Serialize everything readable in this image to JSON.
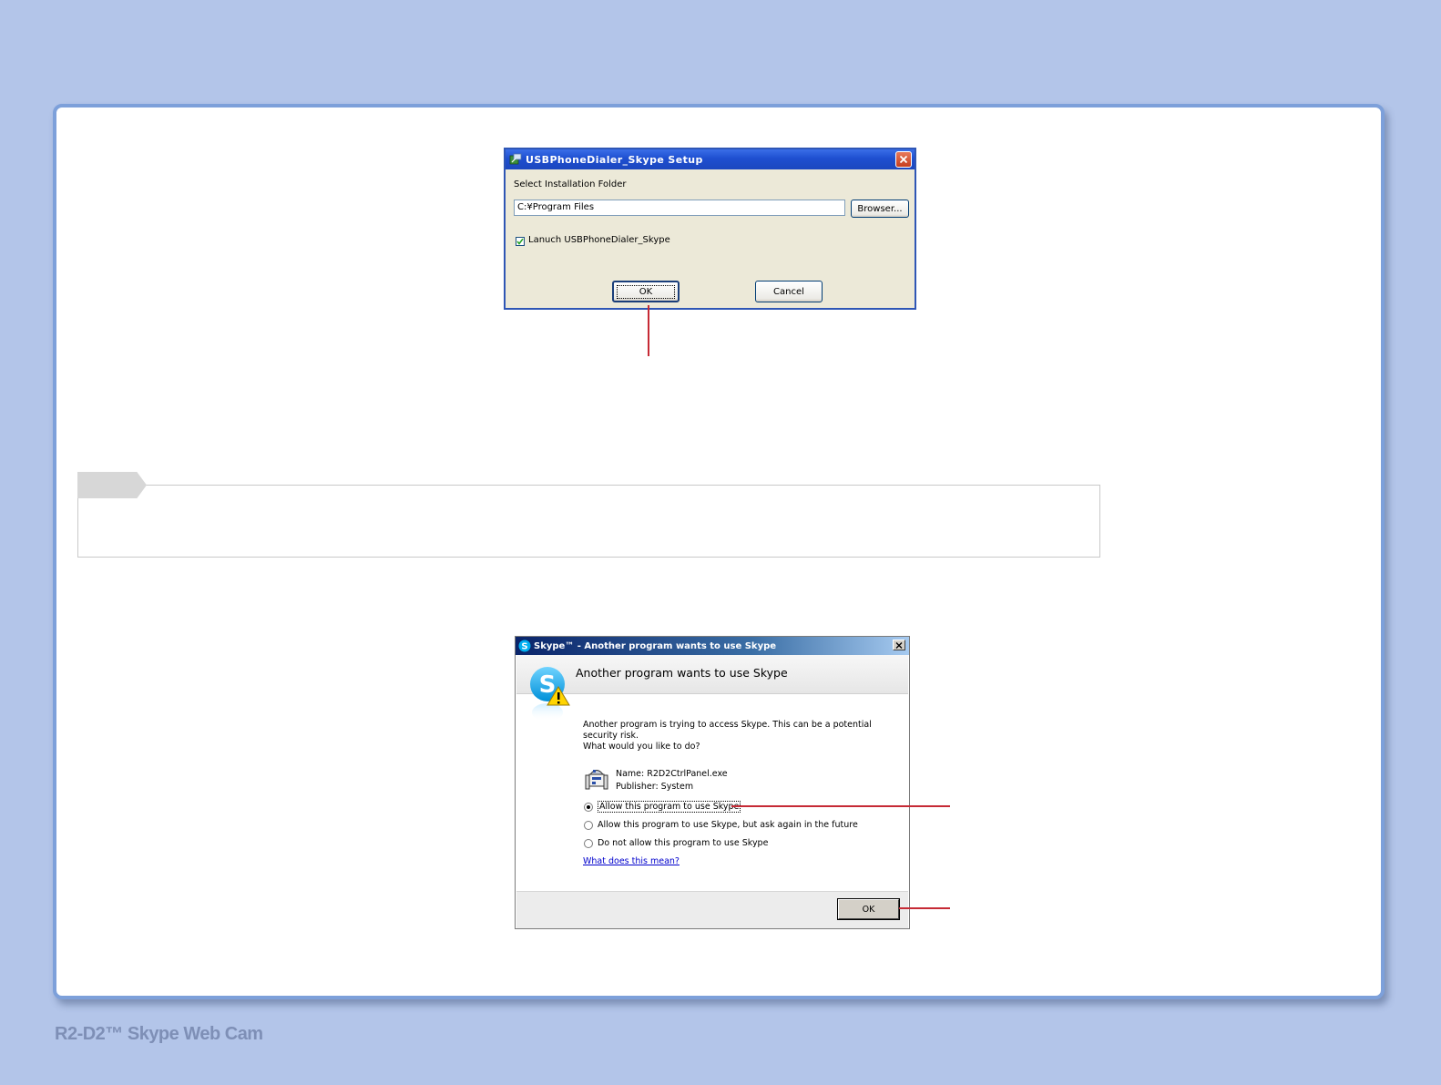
{
  "footer": {
    "title": "R2-D2™ Skype Web Cam"
  },
  "setup_dialog": {
    "title": "USBPhoneDialer_Skype Setup",
    "folder_label": "Select Installation Folder",
    "path_value": "C:¥Program Files",
    "browse_label": "Browser...",
    "launch_label": "Lanuch USBPhoneDialer_Skype",
    "launch_checked": true,
    "ok_label": "OK",
    "cancel_label": "Cancel"
  },
  "skype_dialog": {
    "title": "Skype™ - Another program wants to use Skype",
    "header": "Another program wants to use Skype",
    "body_line1": "Another program is trying to access Skype. This can be a potential security risk.",
    "body_line2": "What would you like to do?",
    "program_name": "Name: R2D2CtrlPanel.exe",
    "program_publisher": "Publisher: System",
    "options": [
      {
        "label": "Allow this program to use Skype",
        "selected": true
      },
      {
        "label": "Allow this program to use Skype, but ask again in the future",
        "selected": false
      },
      {
        "label": "Do not allow this program to use Skype",
        "selected": false
      }
    ],
    "help_link": "What does this mean?",
    "ok_label": "OK"
  },
  "icons": [
    "setup-app-icon",
    "close-icon",
    "checkmark-icon",
    "skype-logo-icon",
    "warning-icon",
    "r2d2-program-icon"
  ],
  "colors": {
    "background": "#b3c5e9",
    "panel_border": "#7da0da",
    "callout": "#c62a35",
    "xp_title": "#1e4fd0"
  }
}
